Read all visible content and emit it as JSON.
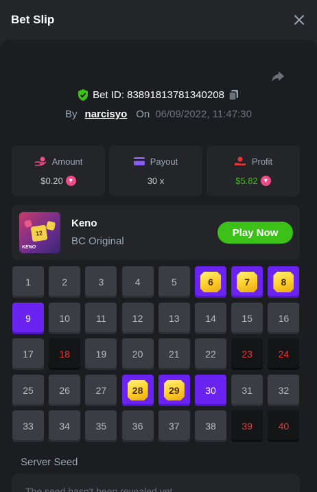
{
  "header": {
    "title": "Bet Slip"
  },
  "bet": {
    "id_label": "Bet ID: 83891813781340208",
    "by_label": "By",
    "user": "narcisyo",
    "on_label": "On",
    "date": "06/09/2022, 11:47:30"
  },
  "stats": [
    {
      "label": "Amount",
      "value": "$0.20",
      "icon": "hand-coin-icon",
      "color": "#eb4e86"
    },
    {
      "label": "Payout",
      "value": "30 x",
      "icon": "card-icon",
      "color": "#8a5cf6"
    },
    {
      "label": "Profit",
      "value": "$5.82",
      "icon": "money-hand-icon",
      "color": "#e63838"
    }
  ],
  "game": {
    "name": "Keno",
    "subtitle": "BC Original",
    "play_label": "Play Now",
    "thumb_die_a": "12",
    "thumb_label": "KENO"
  },
  "keno": {
    "numbers": [
      "1",
      "2",
      "3",
      "4",
      "5",
      "6",
      "7",
      "8",
      "9",
      "10",
      "11",
      "12",
      "13",
      "14",
      "15",
      "16",
      "17",
      "18",
      "19",
      "20",
      "21",
      "22",
      "23",
      "24",
      "25",
      "26",
      "27",
      "28",
      "29",
      "30",
      "31",
      "32",
      "33",
      "34",
      "35",
      "36",
      "37",
      "38",
      "39",
      "40"
    ],
    "hits": [
      6,
      7,
      8,
      28,
      29
    ],
    "picked": [
      9,
      30
    ],
    "misses": [
      18,
      23,
      24,
      39,
      40
    ]
  },
  "seed": {
    "label": "Server Seed",
    "value": "The seed hasn't been revealed yet"
  },
  "colors": {
    "accent": "#6b23f2",
    "green": "#3bc117",
    "red": "#e63838"
  }
}
